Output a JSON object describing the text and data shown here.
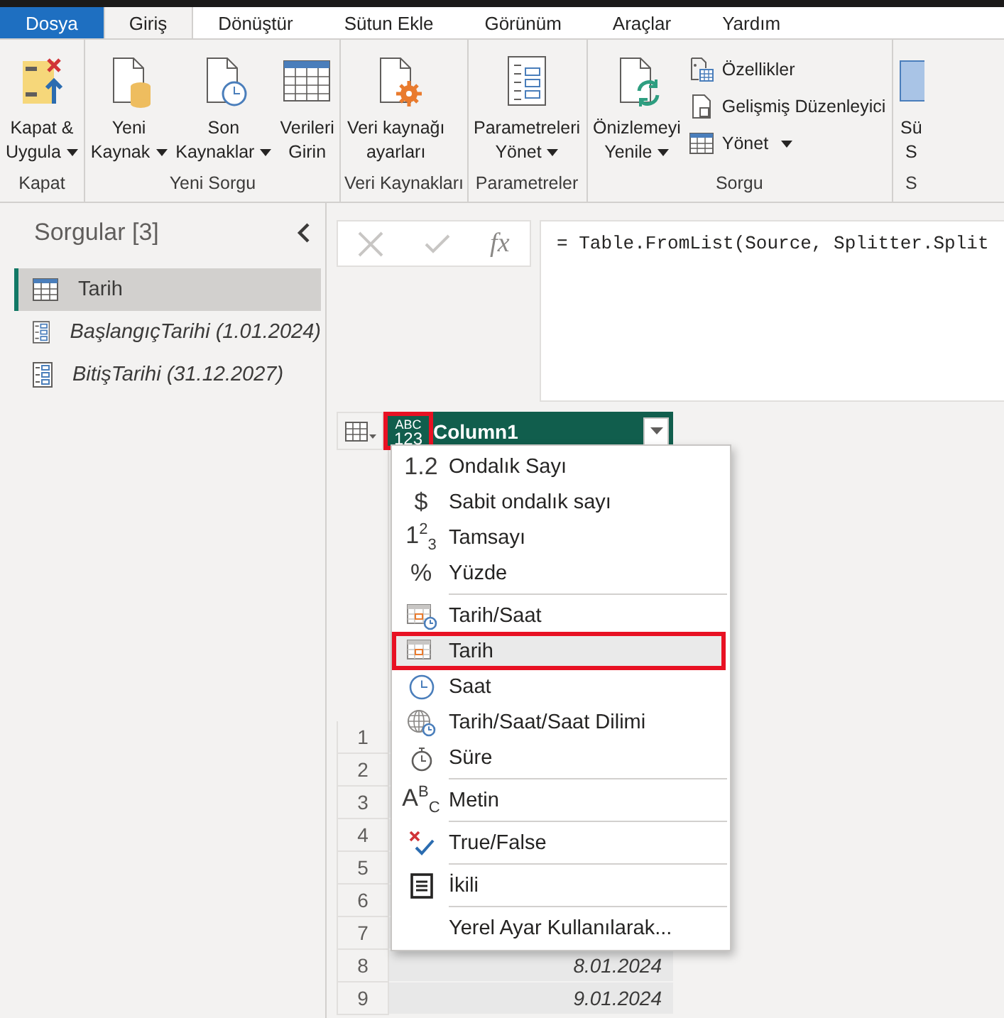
{
  "tabs": [
    {
      "label": "Dosya",
      "kind": "file",
      "selected": false
    },
    {
      "label": "Giriş",
      "kind": "tab",
      "selected": true
    },
    {
      "label": "Dönüştür",
      "kind": "tab",
      "selected": false
    },
    {
      "label": "Sütun Ekle",
      "kind": "tab",
      "selected": false
    },
    {
      "label": "Görünüm",
      "kind": "tab",
      "selected": false
    },
    {
      "label": "Araçlar",
      "kind": "tab",
      "selected": false
    },
    {
      "label": "Yardım",
      "kind": "tab",
      "selected": false
    }
  ],
  "ribbon": {
    "groups": [
      {
        "label": "Kapat",
        "buttons": [
          {
            "kind": "close-apply",
            "lines": [
              "Kapat &",
              "Uygula"
            ],
            "dropdown": true
          }
        ]
      },
      {
        "label": "Yeni Sorgu",
        "buttons": [
          {
            "kind": "new-source",
            "lines": [
              "Yeni",
              "Kaynak"
            ],
            "dropdown": true
          },
          {
            "kind": "recent",
            "lines": [
              "Son",
              "Kaynaklar"
            ],
            "dropdown": true
          },
          {
            "kind": "enter-data",
            "lines": [
              "Verileri",
              "Girin"
            ],
            "dropdown": false
          }
        ]
      },
      {
        "label": "Veri Kaynakları",
        "buttons": [
          {
            "kind": "source-settings",
            "lines": [
              "Veri kaynağı",
              "ayarları"
            ],
            "dropdown": false
          }
        ]
      },
      {
        "label": "Parametreler",
        "buttons": [
          {
            "kind": "parameters",
            "lines": [
              "Parametreleri",
              "Yönet"
            ],
            "dropdown": true
          }
        ]
      },
      {
        "label": "Sorgu",
        "buttons": [
          {
            "kind": "refresh",
            "lines": [
              "Önizlemeyi",
              "Yenile"
            ],
            "dropdown": true
          }
        ],
        "small_buttons": [
          {
            "kind": "properties",
            "label": "Özellikler",
            "dropdown": false
          },
          {
            "kind": "editor",
            "label": "Gelişmiş Düzenleyici",
            "dropdown": false
          },
          {
            "kind": "manage",
            "label": "Yönet",
            "dropdown": true
          }
        ]
      },
      {
        "label": "S",
        "buttons": [
          {
            "kind": "column",
            "lines": [
              "Sü",
              "S"
            ],
            "dropdown": false
          }
        ]
      }
    ]
  },
  "queries": {
    "title": "Sorgular [3]",
    "items": [
      {
        "label": "Tarih",
        "kind": "table",
        "selected": true
      },
      {
        "label": "BaşlangıçTarihi (1.01.2024)",
        "kind": "parameter",
        "selected": false
      },
      {
        "label": "BitişTarihi (31.12.2027)",
        "kind": "parameter",
        "selected": false
      }
    ]
  },
  "formula_bar": {
    "fx": "fx",
    "formula": "= Table.FromList(Source, Splitter.Split"
  },
  "table": {
    "column": {
      "name": "Column1",
      "type_icon": [
        "ABC",
        "123"
      ],
      "type_icon_highlighted": true
    },
    "rows": [
      {
        "number": "1"
      },
      {
        "number": "2"
      },
      {
        "number": "3"
      },
      {
        "number": "4"
      },
      {
        "number": "5"
      },
      {
        "number": "6"
      },
      {
        "number": "7"
      },
      {
        "number": "8",
        "value": "8.01.2024"
      },
      {
        "number": "9",
        "value": "9.01.2024"
      }
    ]
  },
  "type_menu": [
    {
      "kind": "decimal",
      "glyph": "1.2",
      "label": "Ondalık Sayı",
      "divider_above": false,
      "selected": false
    },
    {
      "kind": "currency",
      "glyph": "$",
      "label": "Sabit ondalık sayı",
      "divider_above": false,
      "selected": false
    },
    {
      "kind": "integer",
      "glyph": "1$^{2}$$_{3}$",
      "label": "Tamsayı",
      "divider_above": false,
      "selected": false
    },
    {
      "kind": "percent",
      "glyph": "%",
      "label": "Yüzde",
      "divider_above": false,
      "selected": false
    },
    {
      "kind": "datetime",
      "label": "Tarih/Saat",
      "divider_above": true,
      "selected": false
    },
    {
      "kind": "date",
      "label": "Tarih",
      "divider_above": false,
      "selected": true
    },
    {
      "kind": "time",
      "label": "Saat",
      "divider_above": false,
      "selected": false
    },
    {
      "kind": "datetimezone",
      "label": "Tarih/Saat/Saat Dilimi",
      "divider_above": false,
      "selected": false
    },
    {
      "kind": "duration",
      "label": "Süre",
      "divider_above": false,
      "selected": false
    },
    {
      "kind": "text",
      "glyph": "A$^{B}$$_{C}$",
      "label": "Metin",
      "divider_above": true,
      "selected": false
    },
    {
      "kind": "logical",
      "label": "True/False",
      "divider_above": true,
      "selected": false
    },
    {
      "kind": "binary",
      "label": "İkili",
      "divider_above": true,
      "selected": false
    },
    {
      "kind": "locale",
      "label": "Yerel Ayar Kullanılarak...",
      "divider_above": true,
      "selected": false
    }
  ]
}
